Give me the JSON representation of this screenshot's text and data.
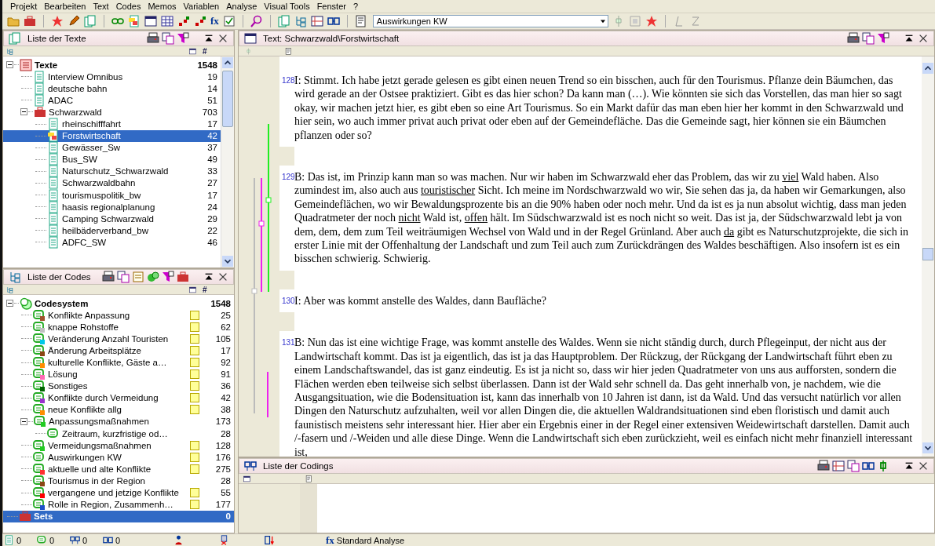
{
  "menu": [
    "Projekt",
    "Bearbeiten",
    "Text",
    "Codes",
    "Memos",
    "Variablen",
    "Analyse",
    "Visual Tools",
    "Fenster",
    "?"
  ],
  "toolbar": {
    "function_glyph": "fx",
    "active_code": "Auswirkungen KW"
  },
  "texts_panel": {
    "title": "Liste der Texte",
    "count_header": "#",
    "items": [
      {
        "kind": "root",
        "label": "Texte",
        "count": "1548",
        "selected": false,
        "expanded": true,
        "children": [
          {
            "kind": "text",
            "label": "Interview Omnibus",
            "count": "19",
            "selected": false
          },
          {
            "kind": "text",
            "label": "deutsche bahn",
            "count": "14",
            "selected": false
          },
          {
            "kind": "text",
            "label": "ADAC",
            "count": "51",
            "selected": false
          },
          {
            "kind": "group",
            "label": "Schwarzwald",
            "count": "703",
            "selected": false,
            "expanded": true,
            "children": [
              {
                "kind": "text",
                "label": "rheinschifffahrt",
                "count": "17",
                "selected": false
              },
              {
                "kind": "open",
                "label": "Forstwirtschaft",
                "count": "42",
                "selected": true
              },
              {
                "kind": "text",
                "label": "Gewässer_Sw",
                "count": "37",
                "selected": false
              },
              {
                "kind": "text",
                "label": "Bus_SW",
                "count": "49",
                "selected": false
              },
              {
                "kind": "text",
                "label": "Naturschutz_Schwarzwald",
                "count": "33",
                "selected": false
              },
              {
                "kind": "text",
                "label": "Schwarzwaldbahn",
                "count": "27",
                "selected": false
              },
              {
                "kind": "text",
                "label": "tourismuspolitik_bw",
                "count": "17",
                "selected": false
              },
              {
                "kind": "text",
                "label": "haasis regionalplanung",
                "count": "24",
                "selected": false
              },
              {
                "kind": "text",
                "label": "Camping Schwarzwald",
                "count": "29",
                "selected": false
              },
              {
                "kind": "text",
                "label": "heilbäderverband_bw",
                "count": "22",
                "selected": false
              },
              {
                "kind": "text",
                "label": "ADFC_SW",
                "count": "46",
                "selected": false
              }
            ]
          }
        ]
      }
    ]
  },
  "codes_panel": {
    "title": "Liste der Codes",
    "count_header": "#",
    "items": [
      {
        "kind": "root",
        "label": "Codesystem",
        "count": "1548",
        "selected": false,
        "expanded": true,
        "children": [
          {
            "kind": "code",
            "label": "Konflikte Anpassung",
            "color": "#a0522d",
            "memo": true,
            "count": "25",
            "selected": false
          },
          {
            "kind": "code",
            "label": "knappe Rohstoffe",
            "color": "#c0c0c0",
            "memo": true,
            "count": "62",
            "selected": false
          },
          {
            "kind": "code",
            "label": "Veränderung Anzahl Touristen",
            "color": "#00c8e8",
            "memo": true,
            "count": "105",
            "selected": false
          },
          {
            "kind": "code",
            "label": "Änderung Arbeitsplätze",
            "color": "#8b4513",
            "memo": true,
            "count": "17",
            "selected": false
          },
          {
            "kind": "code",
            "label": "kulturelle Konflikte, Gäste a…",
            "color": "#ff8c00",
            "memo": true,
            "count": "92",
            "selected": false
          },
          {
            "kind": "code",
            "label": "Lösung",
            "color": "#ff69b4",
            "memo": true,
            "count": "91",
            "selected": false
          },
          {
            "kind": "code",
            "label": "Sonstiges",
            "color": "#006400",
            "memo": true,
            "count": "36",
            "selected": false
          },
          {
            "kind": "code",
            "label": "Konflikte durch Vermeidung",
            "color": "#9932cc",
            "memo": true,
            "count": "42",
            "selected": false
          },
          {
            "kind": "code",
            "label": "neue Konflikte allg",
            "color": "#ff8c00",
            "memo": true,
            "count": "38",
            "selected": false
          },
          {
            "kind": "code",
            "label": "Anpassungsmaßnahmen",
            "color": "#22cc22",
            "memo": false,
            "count": "173",
            "selected": false,
            "expanded": true,
            "children": [
              {
                "kind": "plain",
                "label": "Zeitraum, kurzfristige od…",
                "memo": false,
                "count": "28",
                "selected": false
              }
            ]
          },
          {
            "kind": "code",
            "label": "Vermeidungsmaßnahmen",
            "color": "#22cc22",
            "memo": true,
            "count": "128",
            "selected": false
          },
          {
            "kind": "plain",
            "label": "Auswirkungen KW",
            "memo": true,
            "count": "176",
            "selected": false
          },
          {
            "kind": "code",
            "label": "aktuelle und alte Konflikte",
            "color": "#ff3030",
            "memo": true,
            "count": "275",
            "selected": false
          },
          {
            "kind": "code",
            "label": "Tourismus in der Region",
            "color": "#8b4513",
            "memo": false,
            "count": "28",
            "selected": false
          },
          {
            "kind": "code",
            "label": "vergangene und jetzige Konflikte",
            "color": "#ff0000",
            "memo": true,
            "count": "55",
            "selected": false
          },
          {
            "kind": "code",
            "label": "Rolle in Region, Zusammenh…",
            "color": "#1e50c8",
            "memo": true,
            "count": "177",
            "selected": false
          }
        ]
      },
      {
        "kind": "set",
        "label": "Sets",
        "count": "0",
        "selected": true
      }
    ]
  },
  "text_panel": {
    "title": "Text: Schwarzwald\\Forstwirtschaft",
    "paragraphs": [
      {
        "number": "128",
        "segments": [
          {
            "text": "I: Stimmt. Ich habe jetzt gerade gelesen es gibt einen neuen Trend so ein bisschen, auch für den Tourismus. Pflanze dein Bäumchen, das wird gerade an der Ostsee praktiziert. Gibt es das hier schon? Da kann man (…). Wie könnten sie sich das Vorstellen, das man hier so sagt okay, wir machen jetzt hier, es gibt eben so eine Art Tourismus. So ein Markt dafür das man eben hier her kommt in den Schwarzwald und hier sein, wo auch immer privat auch privat oder eben auf der Gemeindefläche. Das die Gemeinde sagt, hier können sie ein Bäumchen pflanzen oder so?",
            "underline": false
          }
        ]
      },
      {
        "number": "129",
        "segments": [
          {
            "text": "B: Das ist, im Prinzip kann man so was machen. Nur wir haben im Schwarzwald eher das Problem, das wir zu ",
            "underline": false
          },
          {
            "text": "viel",
            "underline": true
          },
          {
            "text": " Wald haben. Also zumindest im, also auch aus ",
            "underline": false
          },
          {
            "text": "touristischer",
            "underline": true
          },
          {
            "text": " Sicht. Ich meine im Nordschwarzwald wo wir, Sie sehen das ja, da haben wir Gemarkungen, also Gemeindeflächen, wo wir Bewaldungsprozente bis an die 90% haben oder noch mehr. Und da ist es ja nun absolut wichtig, dass man jeden Quadratmeter der noch ",
            "underline": false
          },
          {
            "text": "nicht",
            "underline": true
          },
          {
            "text": " Wald ist, ",
            "underline": false
          },
          {
            "text": "offen",
            "underline": true
          },
          {
            "text": " hält. Im Südschwarzwald ist es noch nicht so weit. Das ist ja, der Südschwarzwald lebt ja von dem, dem, dem zum Teil weiträumigen Wechsel von Wald und in der Regel Grünland. Aber auch ",
            "underline": false
          },
          {
            "text": "da",
            "underline": true
          },
          {
            "text": " gibt es Naturschutzprojekte, die sich in erster Linie mit der Offenhaltung der Landschaft und zum Teil auch zum Zurückdrängen des Waldes beschäftigen. Also insofern ist es ein bisschen schwierig. Schwierig.",
            "underline": false
          }
        ]
      },
      {
        "number": "130",
        "segments": [
          {
            "text": "I: Aber was kommt anstelle des Waldes, dann Baufläche?",
            "underline": false
          }
        ]
      },
      {
        "number": "131",
        "segments": [
          {
            "text": "B: Nun das ist eine wichtige Frage, was kommt anstelle des Waldes. Wenn sie nicht ständig durch, durch Pflegeinput, der nicht aus der Landwirtschaft kommt. Das ist ja eigentlich, das ist ja das Hauptproblem. Der Rückzug, der Rückgang der Landwirtschaft führt eben zu einem Landschaftswandel, das ist ganz eindeutig. Es ist ja nicht so, dass wir hier jeden Quadratmeter von uns aus aufforsten, sondern die Flächen werden eben teilweise sich selbst überlassen. Dann ist der Wald sehr schnell da. Das geht innerhalb von, je nachdem, wie die Ausgangsituation, wie die Bodensituation ist, kann das innerhalb von 10 Jahren ist dann, ist da Wald. Und das versucht natürlich vor allen Dingen den Naturschutz aufzuhalten, weil vor allen Dingen die, die aktuellen Waldrandsituationen sind eben floristisch und damit auch faunistisch meistens sehr interessant hier. Hier aber ein Ergebnis einer in der Regel einer extensiven Weidewirtschaft darstellen. Damit auch /-fasern und /-Weiden und alle diese Dinge. Wenn die Landwirtschaft sich eben zurückzieht, weil es einfach nicht mehr finanziell interessant ist,",
            "underline": false
          }
        ]
      }
    ]
  },
  "codings_panel": {
    "title": "Liste der Codings"
  },
  "status_bar": {
    "counts": [
      "0",
      "0",
      "0",
      "0"
    ],
    "function_glyph": "fx",
    "analysis": "Standard Analyse"
  }
}
